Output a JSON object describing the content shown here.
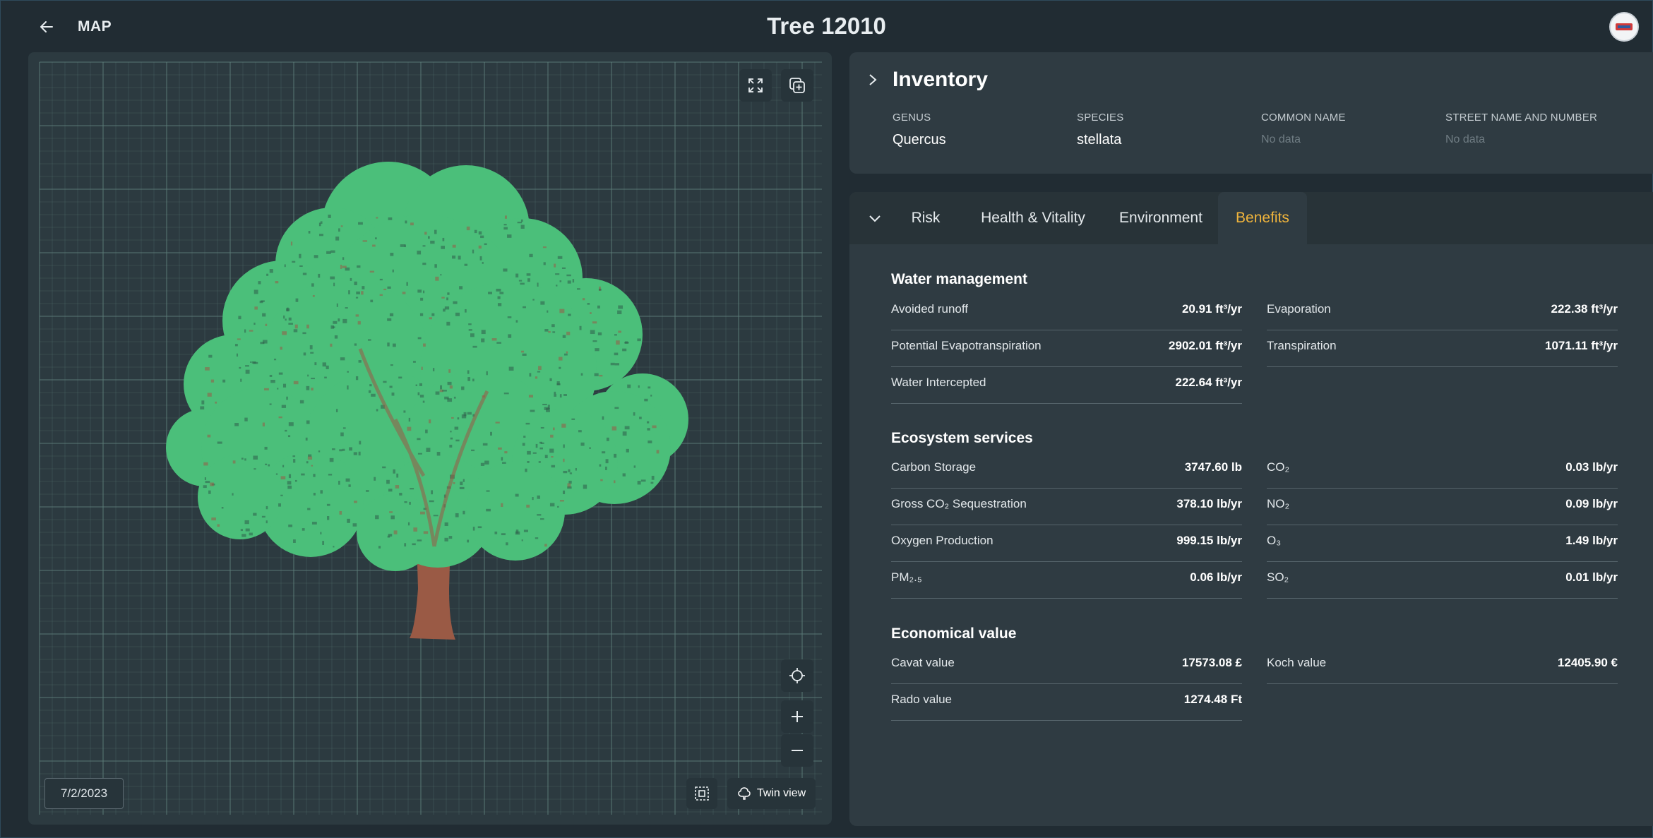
{
  "header": {
    "back_icon": "arrow-left-icon",
    "map_label": "MAP",
    "title": "Tree 12010",
    "avatar_icon": "logo-avatar"
  },
  "viewer": {
    "fullscreen_icon": "expand-icon",
    "add_layer_icon": "copy-plus-icon",
    "locate_icon": "crosshair-icon",
    "zoom_in_icon": "plus-icon",
    "zoom_out_icon": "minus-icon",
    "select_icon": "selection-icon",
    "date": "7/2/2023",
    "twin_view_label": "Twin view",
    "tree_colors": {
      "canopy": "#4bbf7a",
      "trunk": "#9a5a45",
      "grid": "#5f7f7b",
      "background": "#2c3a40"
    }
  },
  "inventory": {
    "title": "Inventory",
    "fields": [
      {
        "label": "GENUS",
        "value": "Quercus"
      },
      {
        "label": "SPECIES",
        "value": "stellata"
      },
      {
        "label": "COMMON NAME",
        "value": "No data"
      },
      {
        "label": "STREET NAME AND NUMBER",
        "value": "No data"
      }
    ]
  },
  "tabs": {
    "items": [
      {
        "label": "Risk"
      },
      {
        "label": "Health & Vitality"
      },
      {
        "label": "Environment"
      },
      {
        "label": "Benefits"
      }
    ],
    "active": "Benefits",
    "accent_color": "#f0b43c"
  },
  "benefits": {
    "water": {
      "title": "Water management",
      "left": [
        {
          "label": "Avoided runoff",
          "value": "20.91 ft³/yr"
        },
        {
          "label": "Potential Evapotranspiration",
          "value": "2902.01 ft³/yr"
        },
        {
          "label": "Water Intercepted",
          "value": "222.64 ft³/yr"
        }
      ],
      "right": [
        {
          "label": "Evaporation",
          "value": "222.38 ft³/yr"
        },
        {
          "label": "Transpiration",
          "value": "1071.11 ft³/yr"
        }
      ]
    },
    "ecosystem": {
      "title": "Ecosystem services",
      "left": [
        {
          "label": "Carbon Storage",
          "value": "3747.60 lb"
        },
        {
          "label": "Gross CO₂ Sequestration",
          "value": "378.10 lb/yr"
        },
        {
          "label": "Oxygen Production",
          "value": "999.15 lb/yr"
        },
        {
          "label": "PM₂.₅",
          "value": "0.06 lb/yr"
        }
      ],
      "right": [
        {
          "label": "CO₂",
          "value": "0.03 lb/yr"
        },
        {
          "label": "NO₂",
          "value": "0.09 lb/yr"
        },
        {
          "label": "O₃",
          "value": "1.49 lb/yr"
        },
        {
          "label": "SO₂",
          "value": "0.01 lb/yr"
        }
      ]
    },
    "economical": {
      "title": "Economical value",
      "left": [
        {
          "label": "Cavat value",
          "value": "17573.08 £"
        },
        {
          "label": "Rado value",
          "value": "1274.48 Ft"
        }
      ],
      "right": [
        {
          "label": "Koch value",
          "value": "12405.90 €"
        }
      ]
    }
  }
}
